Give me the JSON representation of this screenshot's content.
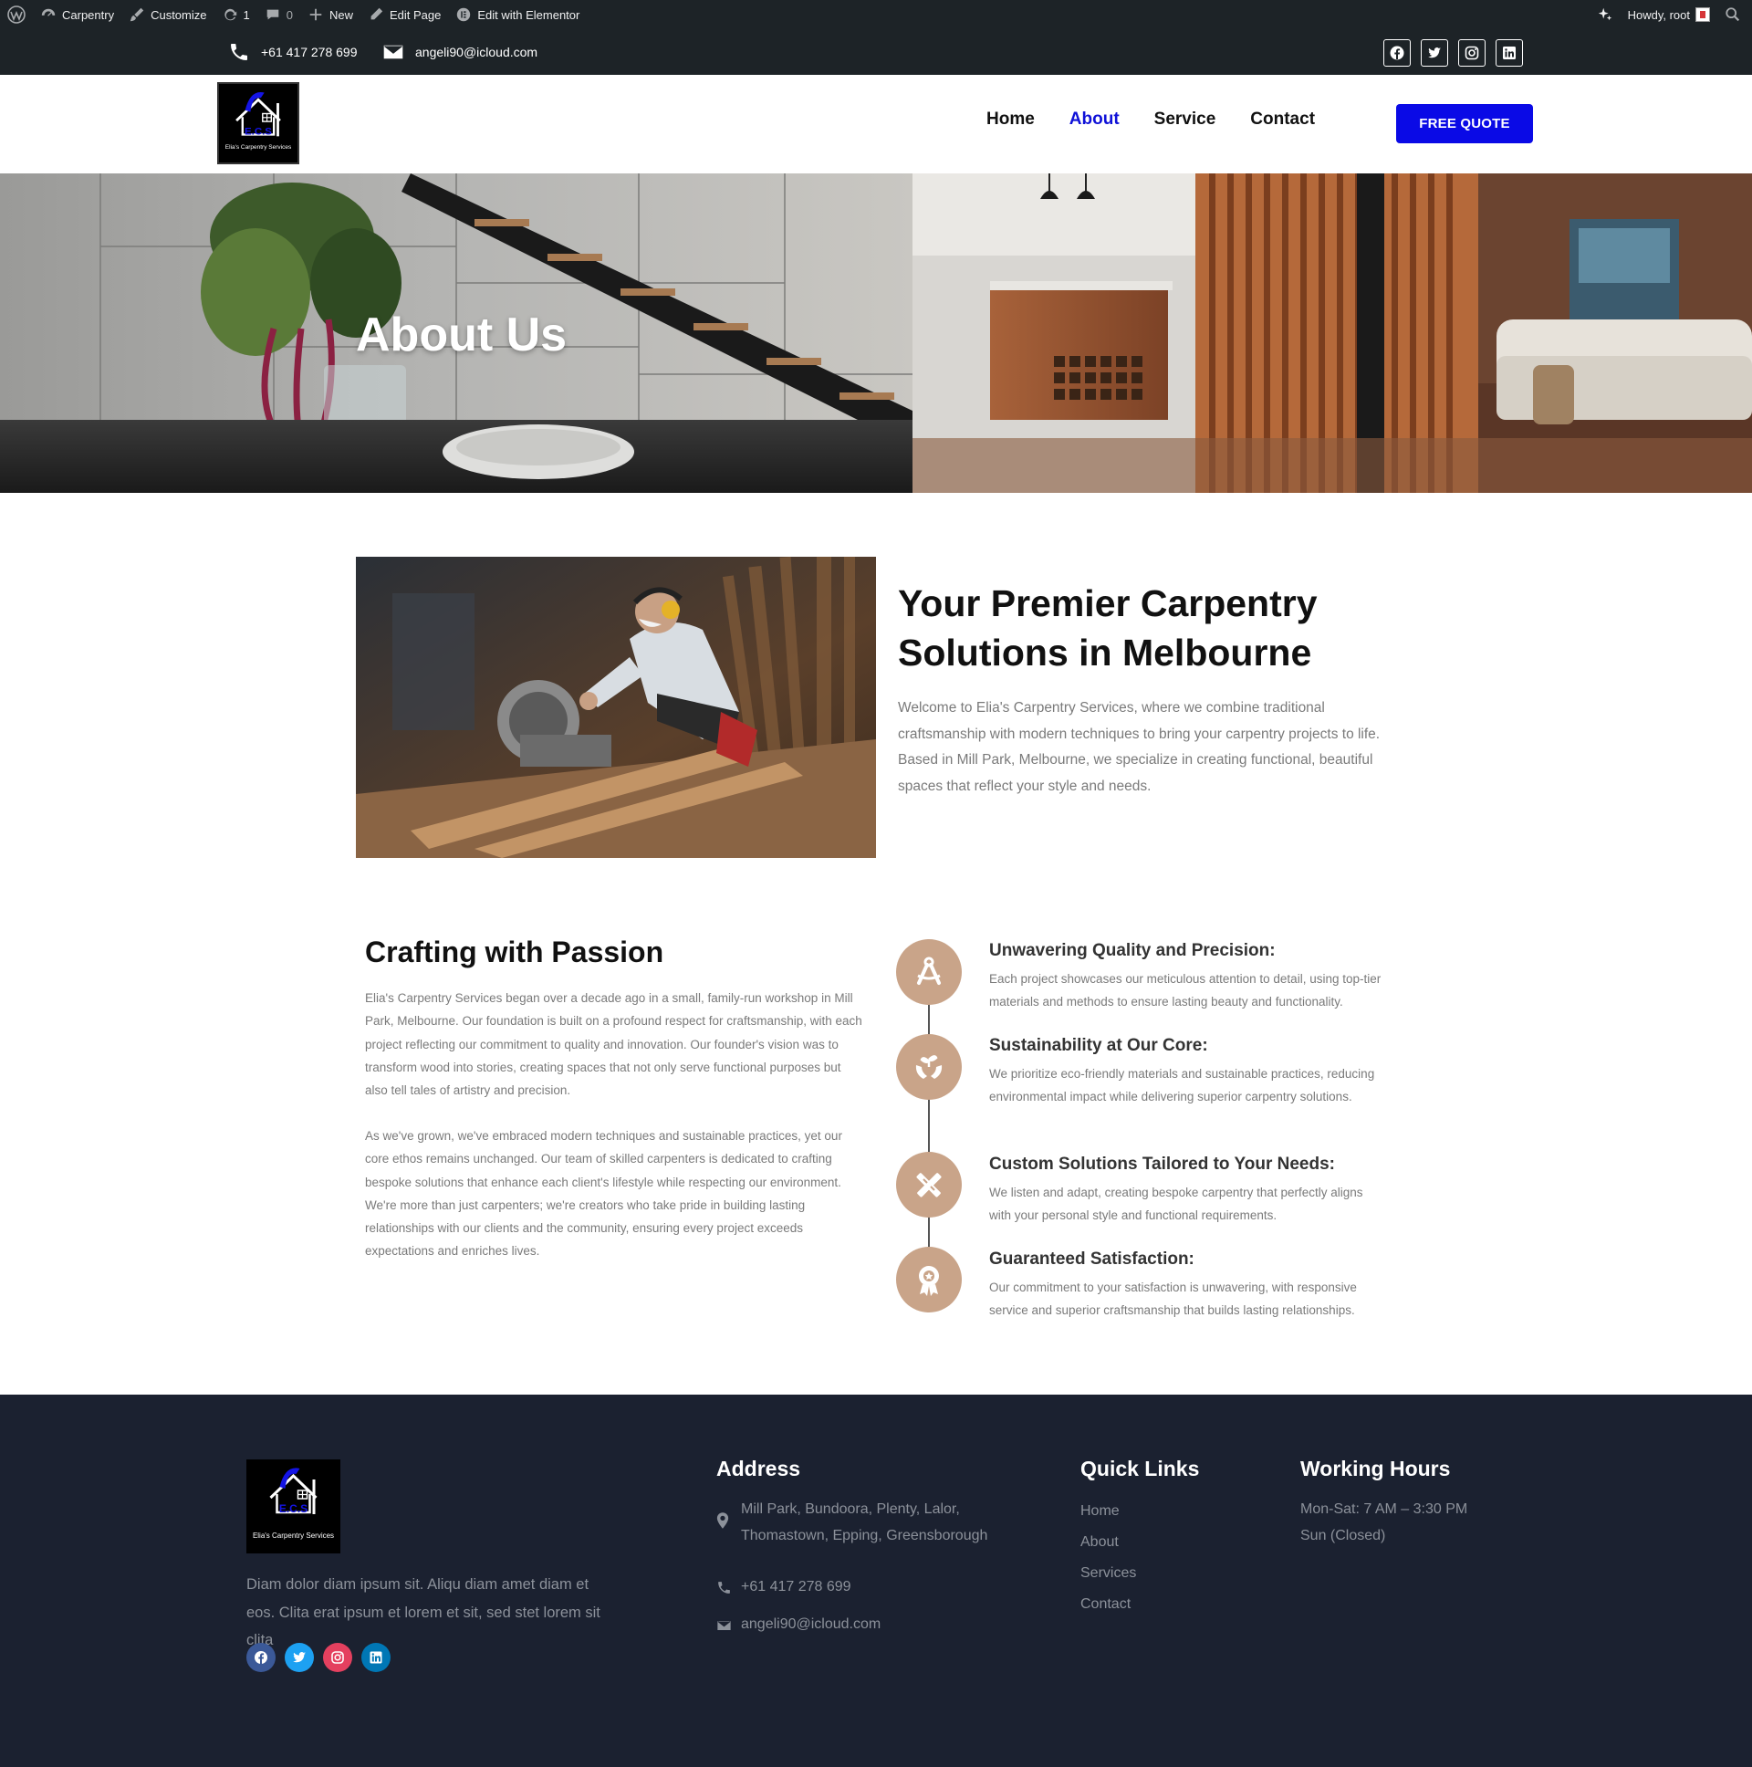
{
  "admin_bar": {
    "site_name": "Carpentry",
    "customize": "Customize",
    "updates_count": "1",
    "comments_count": "0",
    "new_label": "New",
    "edit_page": "Edit Page",
    "edit_elementor": "Edit with Elementor",
    "howdy": "Howdy, root"
  },
  "topbar": {
    "phone": "+61 417 278 699",
    "email": "angeli90@icloud.com",
    "socials": [
      "facebook-icon",
      "twitter-icon",
      "instagram-icon",
      "linkedin-icon"
    ]
  },
  "header": {
    "logo_text": "Elia's Carpentry Services",
    "logo_initials": "E.C.S",
    "nav": [
      {
        "label": "Home",
        "active": false
      },
      {
        "label": "About",
        "active": true
      },
      {
        "label": "Service",
        "active": false
      },
      {
        "label": "Contact",
        "active": false
      }
    ],
    "cta": "FREE QUOTE",
    "accent_color": "#0a0ae6"
  },
  "hero": {
    "title": "About Us"
  },
  "intro": {
    "title": "Your Premier Carpentry Solutions in Melbourne",
    "text": "Welcome to Elia's Carpentry Services, where we combine traditional craftsmanship with modern techniques to bring your carpentry projects to life. Based in Mill Park, Melbourne, we specialize in creating functional, beautiful spaces that reflect your style and needs."
  },
  "passion": {
    "title": "Crafting with Passion",
    "paragraphs": [
      "Elia's Carpentry Services began over a decade ago in a small, family-run workshop in Mill Park, Melbourne. Our foundation is built on a profound respect for craftsmanship, with each project reflecting our commitment to quality and innovation. Our founder's vision was to transform wood into stories, creating spaces that not only serve functional purposes but also tell tales of artistry and precision.",
      "As we've grown, we've embraced modern techniques and sustainable practices, yet our core ethos remains unchanged. Our team of skilled carpenters is dedicated to crafting bespoke solutions that enhance each client's lifestyle while respecting our environment. We're more than just carpenters; we're creators who take pride in building lasting relationships with our clients and the community, ensuring every project exceeds expectations and enriches lives."
    ]
  },
  "features": [
    {
      "icon": "drafting-compass-icon",
      "title": "Unwavering Quality and Precision:",
      "text": "Each project showcases our meticulous attention to detail, using top-tier materials and methods to ensure lasting beauty and functionality."
    },
    {
      "icon": "hands-seedling-icon",
      "title": "Sustainability at Our Core:",
      "text": "We prioritize eco-friendly materials and sustainable practices, reducing environmental impact while delivering superior carpentry solutions."
    },
    {
      "icon": "pencil-ruler-icon",
      "title": "Custom Solutions Tailored to Your Needs:",
      "text": "We listen and adapt, creating bespoke carpentry that perfectly aligns with your personal style and functional requirements."
    },
    {
      "icon": "award-medal-icon",
      "title": "Guaranteed Satisfaction:",
      "text": "Our commitment to your satisfaction is unwavering, with responsive service and superior craftsmanship that builds lasting relationships."
    }
  ],
  "feature_color": "#c9a489",
  "footer": {
    "description": "Diam dolor diam ipsum sit. Aliqu diam amet diam et eos. Clita erat ipsum et lorem et sit, sed stet lorem sit clita",
    "address_title": "Address",
    "address": "Mill Park, Bundoora, Plenty, Lalor, Thomastown, Epping, Greensborough",
    "phone": "+61 417 278 699",
    "email": "angeli90@icloud.com",
    "links_title": "Quick Links",
    "links": [
      "Home",
      "About",
      "Services",
      "Contact"
    ],
    "hours_title": "Working Hours",
    "hours": [
      "Mon-Sat: 7 AM – 3:30 PM",
      "Sun (Closed)"
    ],
    "socials": [
      {
        "icon": "facebook-icon",
        "color": "#3b5998"
      },
      {
        "icon": "twitter-icon",
        "color": "#1da1f2"
      },
      {
        "icon": "instagram-icon",
        "color": "#e4405f"
      },
      {
        "icon": "linkedin-icon",
        "color": "#0077b5"
      }
    ]
  }
}
